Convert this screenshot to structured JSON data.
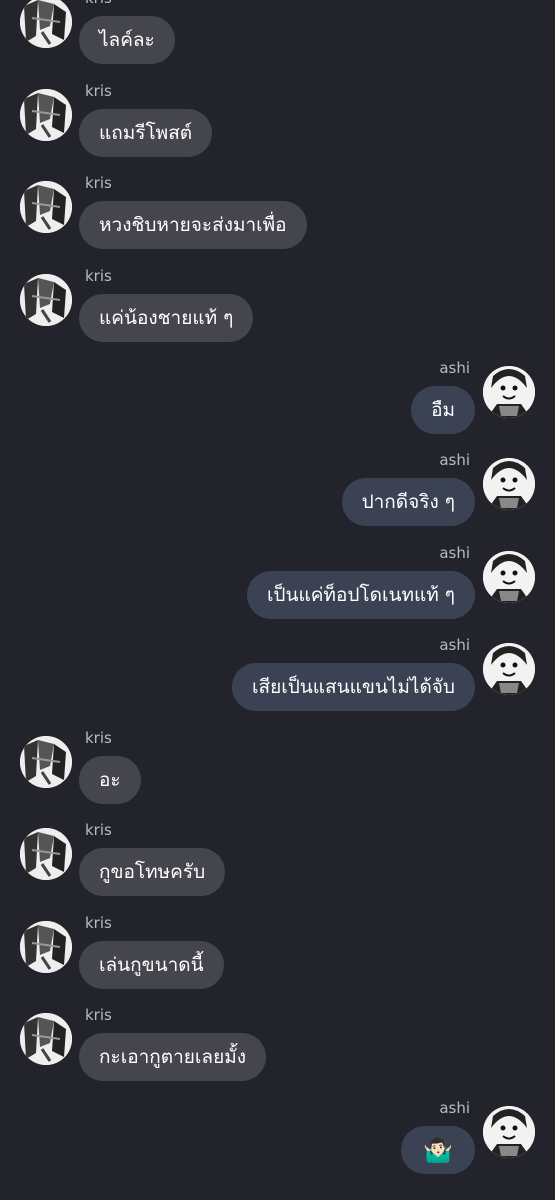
{
  "users": {
    "left": "kris",
    "right": "ashi"
  },
  "messages": [
    {
      "sender": "kris",
      "text": "ไลค์ละ"
    },
    {
      "sender": "kris",
      "text": "แถมรีโพสต์"
    },
    {
      "sender": "kris",
      "text": "หวงชิบหายจะส่งมาเพื่อ"
    },
    {
      "sender": "kris",
      "text": "แค่น้องชายแท้ ๆ"
    },
    {
      "sender": "ashi",
      "text": "อืม"
    },
    {
      "sender": "ashi",
      "text": "ปากดีจริง ๆ"
    },
    {
      "sender": "ashi",
      "text": "เป็นแค่ท็อปโดเนทแท้ ๆ"
    },
    {
      "sender": "ashi",
      "text": "เสียเป็นแสนแขนไม่ได้จับ"
    },
    {
      "sender": "kris",
      "text": "อะ"
    },
    {
      "sender": "kris",
      "text": "กูขอโทษครับ"
    },
    {
      "sender": "kris",
      "text": "เล่นกูขนาดนี้"
    },
    {
      "sender": "kris",
      "text": "กะเอากูตายเลยมั้ง"
    },
    {
      "sender": "ashi",
      "text": "🤷🏻‍♂️"
    }
  ],
  "colors": {
    "background": "#23242b",
    "left_bubble": "#44454d",
    "right_bubble": "#3a4254",
    "name_text": "#b9bac0",
    "message_text": "#ffffff"
  },
  "icons": {
    "left_avatar": "manga-avatar-kris",
    "right_avatar": "manga-avatar-ashi"
  }
}
